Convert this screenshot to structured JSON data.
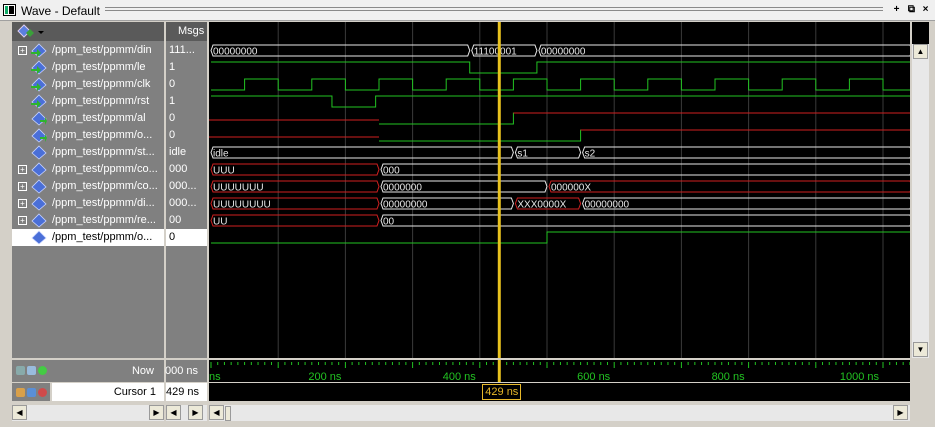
{
  "window": {
    "title": "Wave - Default",
    "buttons": [
      "+",
      "⧉",
      "×"
    ]
  },
  "columns": {
    "msgs_header": "Msgs"
  },
  "signals": [
    {
      "name": "/ppm_test/ppmm/din",
      "value": "111...",
      "expandable": true,
      "icon": "bus-wave-icon"
    },
    {
      "name": "/ppm_test/ppmm/le",
      "value": "1",
      "expandable": false,
      "icon": "input-wave-icon"
    },
    {
      "name": "/ppm_test/ppmm/clk",
      "value": "0",
      "expandable": false,
      "icon": "input-wave-icon"
    },
    {
      "name": "/ppm_test/ppmm/rst",
      "value": "1",
      "expandable": false,
      "icon": "input-wave-icon"
    },
    {
      "name": "/ppm_test/ppmm/al",
      "value": "0",
      "expandable": false,
      "icon": "output-wave-icon"
    },
    {
      "name": "/ppm_test/ppmm/o...",
      "value": "0",
      "expandable": false,
      "icon": "output-wave-icon"
    },
    {
      "name": "/ppm_test/ppmm/st...",
      "value": "idle",
      "expandable": false,
      "icon": "internal-wave-icon"
    },
    {
      "name": "/ppm_test/ppmm/co...",
      "value": "000",
      "expandable": true,
      "icon": "internal-wave-icon"
    },
    {
      "name": "/ppm_test/ppmm/co...",
      "value": "000...",
      "expandable": true,
      "icon": "internal-wave-icon"
    },
    {
      "name": "/ppm_test/ppmm/di...",
      "value": "000...",
      "expandable": true,
      "icon": "internal-wave-icon"
    },
    {
      "name": "/ppm_test/ppmm/re...",
      "value": "00",
      "expandable": true,
      "icon": "internal-wave-icon"
    },
    {
      "name": "/ppm_test/ppmm/o...",
      "value": "0",
      "expandable": false,
      "icon": "internal-wave-icon",
      "selected": true
    }
  ],
  "wave_labels": {
    "din": [
      "00000000",
      "11100001",
      "00000000"
    ],
    "state": [
      "idle",
      "s1",
      "s2"
    ],
    "co1": [
      "UUU",
      "000"
    ],
    "co2": [
      "UUUUUUU",
      "0000000",
      "000000X"
    ],
    "di": [
      "UUUUUUUU",
      "00000000",
      "XXX0000X",
      "00000000"
    ],
    "re": [
      "UU",
      "00"
    ]
  },
  "footer": {
    "now_label": "Now",
    "now_value": "000 ns",
    "cursor_label": "Cursor 1",
    "cursor_value": "429 ns",
    "cursor_tag": "429 ns"
  },
  "timeline": {
    "tick_labels": [
      "ns",
      "200 ns",
      "400 ns",
      "600 ns",
      "800 ns",
      "1000 ns"
    ]
  },
  "colors": {
    "wave_green": "#22c322",
    "wave_red": "#d02020",
    "wave_white": "#e8e8e8",
    "cursor": "#e8c21e",
    "grid": "#3a3a3a"
  }
}
